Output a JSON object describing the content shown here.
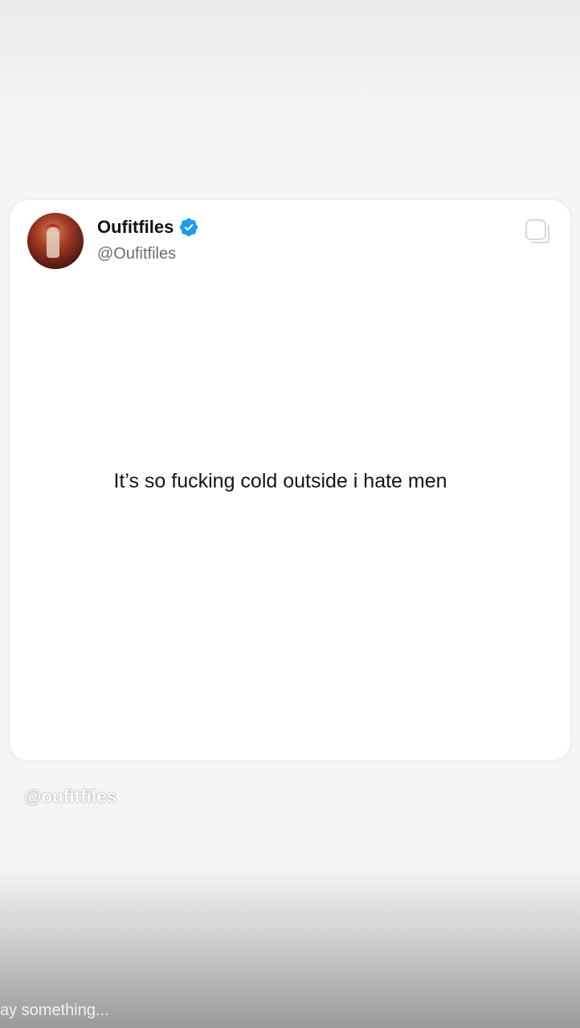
{
  "post": {
    "display_name": "Oufitfiles",
    "handle": "@Oufitfiles",
    "text": "It’s so fucking cold outside i hate men",
    "verified": true,
    "verified_color": "#1d9bf0"
  },
  "overlay": {
    "watermark": "@oufitfiles"
  },
  "reply": {
    "placeholder": "ay something..."
  },
  "icons": {
    "copy": "copy-icon",
    "verified": "verified-badge-icon"
  }
}
